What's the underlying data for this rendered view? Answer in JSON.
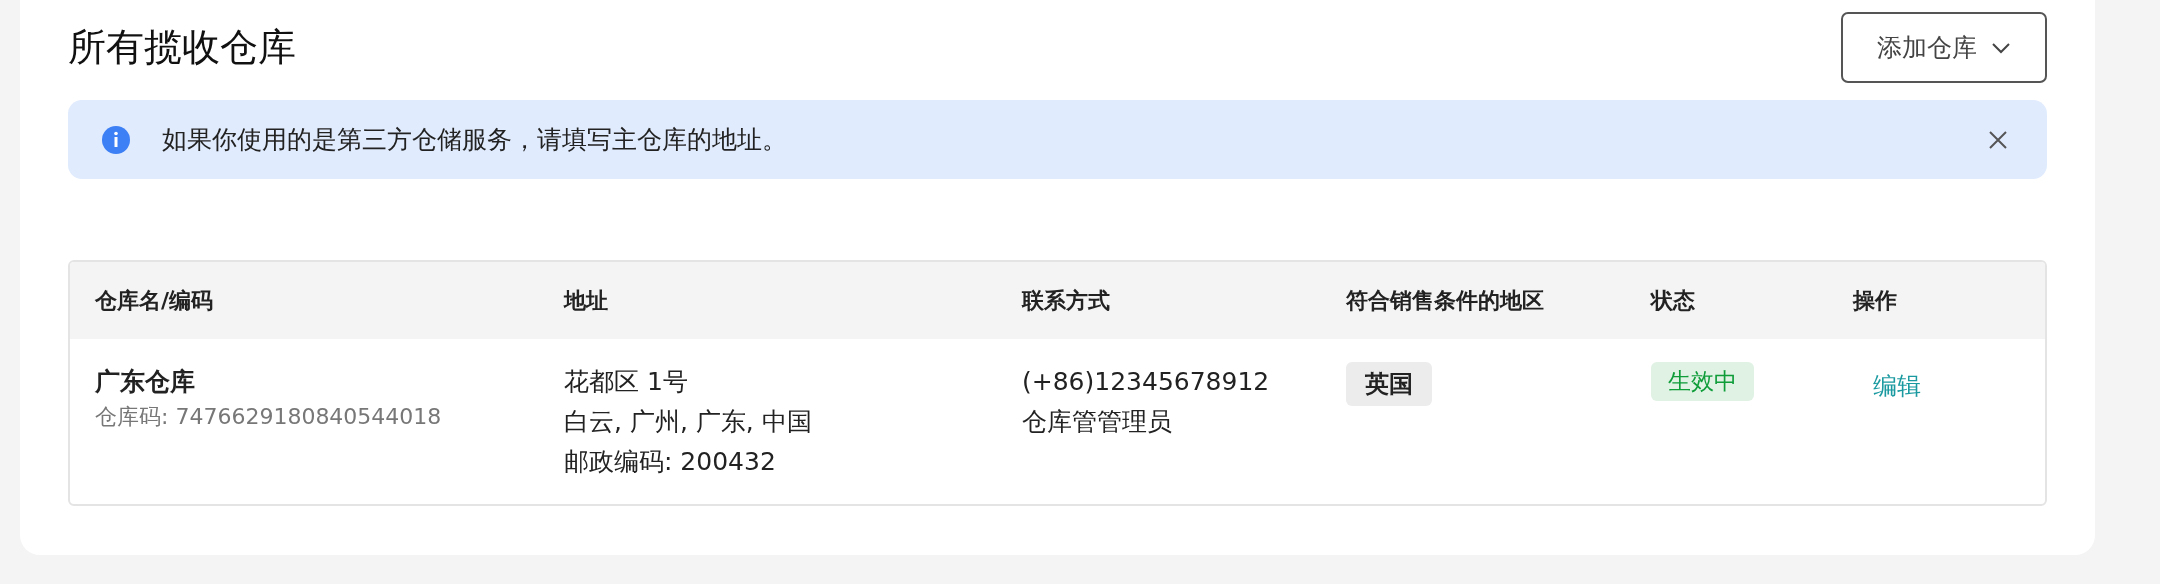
{
  "title": "所有揽收仓库",
  "add_button": {
    "label": "添加仓库"
  },
  "banner": {
    "text": "如果你使用的是第三方仓储服务，请填写主仓库的地址。"
  },
  "table": {
    "columns": [
      "仓库名/编码",
      "地址",
      "联系方式",
      "符合销售条件的地区",
      "状态",
      "操作"
    ],
    "rows": [
      {
        "name": "广东仓库",
        "code": "仓库码: 7476629180840544018",
        "address": [
          "花都区 1号",
          "白云, 广州, 广东, 中国",
          "邮政编码: 200432"
        ],
        "contact": [
          "(+86)12345678912",
          "仓库管管理员"
        ],
        "regions": [
          "英国"
        ],
        "status": {
          "label": "生效中",
          "color": "#0f9d3a"
        },
        "action": "编辑"
      }
    ]
  }
}
